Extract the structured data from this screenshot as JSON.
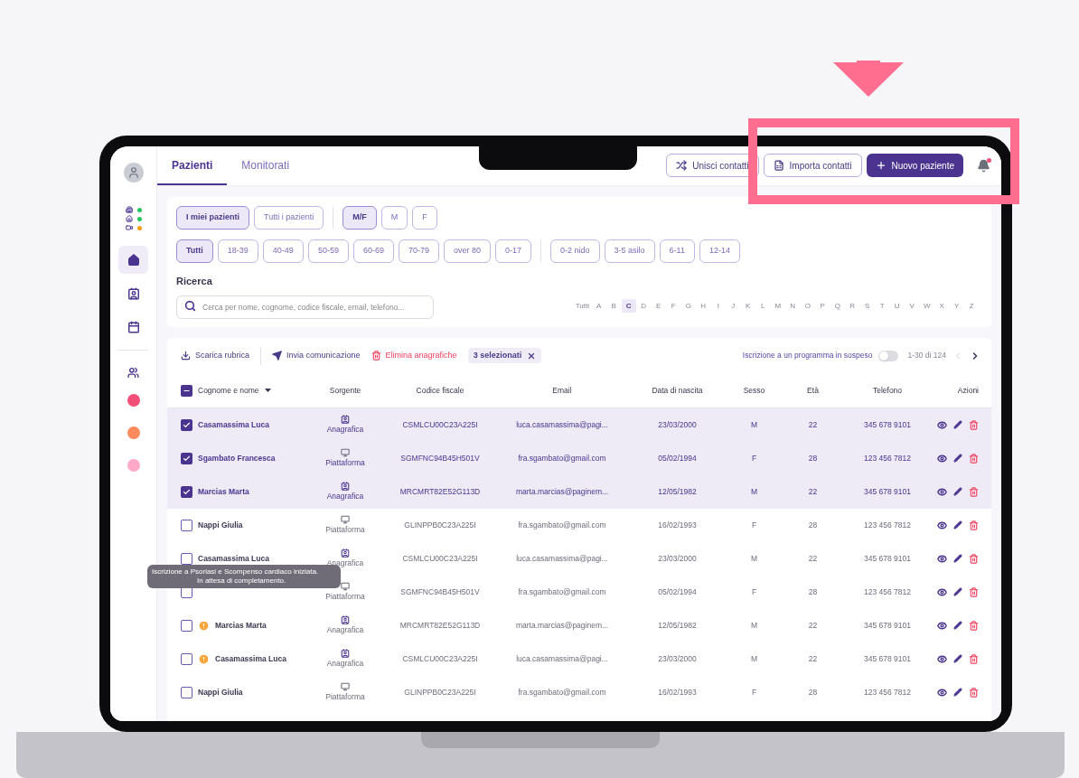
{
  "sidebar": {
    "status": [
      {
        "kind": "building",
        "color": "#22c55e"
      },
      {
        "kind": "home",
        "color": "#22c55e"
      },
      {
        "kind": "video",
        "color": "#f59e0b"
      }
    ],
    "nav": [
      {
        "kind": "home",
        "selected": true
      },
      {
        "kind": "contact",
        "selected": false
      },
      {
        "kind": "calendar",
        "selected": false
      }
    ],
    "groups": [
      {
        "kind": "people"
      }
    ],
    "circles": [
      {
        "color": "#f04f78"
      },
      {
        "color": "#ff8a5c"
      },
      {
        "color": "#ffa9c6"
      }
    ]
  },
  "tabs": [
    {
      "label": "Pazienti",
      "selected": true
    },
    {
      "label": "Monitorati",
      "selected": false
    }
  ],
  "actions": [
    {
      "kind": "merge",
      "label": "Unisci contatti"
    },
    {
      "kind": "import",
      "label": "Importa contatti"
    },
    {
      "kind": "primary",
      "label": "Nuovo paziente"
    }
  ],
  "notifications": {
    "unread": true
  },
  "filters": {
    "scope": [
      {
        "label": "I miei pazienti",
        "selected": true
      },
      {
        "label": "Tutti i pazienti",
        "selected": false
      }
    ],
    "gender": [
      {
        "label": "M/F",
        "selected": true
      },
      {
        "label": "M",
        "selected": false
      },
      {
        "label": "F",
        "selected": false
      }
    ],
    "age": [
      {
        "label": "Tutti",
        "selected": true
      },
      {
        "label": "18-39",
        "selected": false
      },
      {
        "label": "40-49",
        "selected": false
      },
      {
        "label": "50-59",
        "selected": false
      },
      {
        "label": "60-69",
        "selected": false
      },
      {
        "label": "70-79",
        "selected": false
      },
      {
        "label": "over 80",
        "selected": false
      },
      {
        "label": "0-17",
        "selected": false
      }
    ],
    "child_age": [
      {
        "label": "0-2 nido",
        "selected": false
      },
      {
        "label": "3-5 asilo",
        "selected": false
      },
      {
        "label": "6-11",
        "selected": false
      },
      {
        "label": "12-14",
        "selected": false
      }
    ],
    "search_label": "Ricerca",
    "search": {
      "placeholder": "Cerca per nome, cognome, codice fiscale, email, telefono..."
    },
    "letters": [
      {
        "label": "Tutti",
        "selected": false
      },
      {
        "label": "A",
        "selected": false
      },
      {
        "label": "B",
        "selected": false
      },
      {
        "label": "C",
        "selected": true
      },
      {
        "label": "D",
        "selected": false
      },
      {
        "label": "E",
        "selected": false
      },
      {
        "label": "F",
        "selected": false
      },
      {
        "label": "G",
        "selected": false
      },
      {
        "label": "H",
        "selected": false
      },
      {
        "label": "I",
        "selected": false
      },
      {
        "label": "J",
        "selected": false
      },
      {
        "label": "K",
        "selected": false
      },
      {
        "label": "L",
        "selected": false
      },
      {
        "label": "M",
        "selected": false
      },
      {
        "label": "N",
        "selected": false
      },
      {
        "label": "O",
        "selected": false
      },
      {
        "label": "P",
        "selected": false
      },
      {
        "label": "Q",
        "selected": false
      },
      {
        "label": "R",
        "selected": false
      },
      {
        "label": "S",
        "selected": false
      },
      {
        "label": "T",
        "selected": false
      },
      {
        "label": "U",
        "selected": false
      },
      {
        "label": "V",
        "selected": false
      },
      {
        "label": "W",
        "selected": false
      },
      {
        "label": "X",
        "selected": false
      },
      {
        "label": "Y",
        "selected": false
      },
      {
        "label": "Z",
        "selected": false
      }
    ]
  },
  "toolbar": {
    "tools": [
      {
        "kind": "download",
        "label": "Scarica rubrica"
      },
      {
        "kind": "send",
        "label": "Invia comunicazione"
      },
      {
        "kind": "delete",
        "label": "Elimina anagrafiche"
      }
    ],
    "selection": "3 selezionati",
    "pending_label": "Iscrizione a un programma in sospeso",
    "pending_on": false,
    "range": "1-30 di 124",
    "prev_disabled": true,
    "next_disabled": false
  },
  "table": {
    "all_indeterminate": true,
    "columns": [
      "Cognome e nome",
      "Sorgente",
      "Codice fiscale",
      "Email",
      "Data di nascita",
      "Sesso",
      "Età",
      "Telefono",
      "Azioni"
    ],
    "rows": [
      {
        "checked": true,
        "warning": false,
        "name": "Casamassima Luca",
        "kind": "registry",
        "source": "Anagrafica",
        "code": "CSMLCU00C23A225I",
        "email": "luca.casamassima@pagi...",
        "birth": "23/03/2000",
        "sex": "M",
        "age": "22",
        "phone": "345 678 9101"
      },
      {
        "checked": true,
        "warning": false,
        "name": "Sgambato Francesca",
        "kind": "platform",
        "source": "Piattaforma",
        "code": "SGMFNC94B45H501V",
        "email": "fra.sgambato@gmail.com",
        "birth": "05/02/1994",
        "sex": "F",
        "age": "28",
        "phone": "123 456 7812"
      },
      {
        "checked": true,
        "warning": false,
        "name": "Marcias Marta",
        "kind": "registry",
        "source": "Anagrafica",
        "code": "MRCMRT82E52G113D",
        "email": "marta.marcias@paginem...",
        "birth": "12/05/1982",
        "sex": "M",
        "age": "22",
        "phone": "345 678 9101"
      },
      {
        "checked": false,
        "warning": false,
        "name": "Nappi Giulia",
        "kind": "platform",
        "source": "Piattaforma",
        "code": "GLINPPB0C23A225I",
        "email": "fra.sgambato@gmail.com",
        "birth": "16/02/1993",
        "sex": "F",
        "age": "28",
        "phone": "123 456 7812"
      },
      {
        "checked": false,
        "warning": false,
        "name": "Casamassima Luca",
        "kind": "registry",
        "source": "Anagrafica",
        "code": "CSMLCU00C23A225I",
        "email": "luca.casamassima@pagi...",
        "birth": "23/03/2000",
        "sex": "M",
        "age": "22",
        "phone": "345 678 9101"
      },
      {
        "checked": false,
        "warning": false,
        "kind": "platform",
        "source": "Piattaforma",
        "code": "SGMFNC94B45H501V",
        "email": "fra.sgambato@gmail.com",
        "birth": "05/02/1994",
        "sex": "F",
        "age": "28",
        "phone": "123 456 7812",
        "tooltip": [
          "Iscrizione a Psoriasi e Scompenso cardiaco iniziata.",
          "In attesa di completamento."
        ]
      },
      {
        "checked": false,
        "warning": true,
        "name": "Marcias Marta",
        "kind": "registry",
        "source": "Anagrafica",
        "code": "MRCMRT82E52G113D",
        "email": "marta.marcias@paginem...",
        "birth": "12/05/1982",
        "sex": "M",
        "age": "22",
        "phone": "345 678 9101"
      },
      {
        "checked": false,
        "warning": true,
        "name": "Casamassima Luca",
        "kind": "registry",
        "source": "Anagrafica",
        "code": "CSMLCU00C23A225I",
        "email": "luca.casamassima@pagi...",
        "birth": "23/03/2000",
        "sex": "M",
        "age": "22",
        "phone": "345 678 9101"
      },
      {
        "checked": false,
        "warning": false,
        "name": "Nappi Giulia",
        "kind": "platform",
        "source": "Piattaforma",
        "code": "GLINPPB0C23A225I",
        "email": "fra.sgambato@gmail.com",
        "birth": "16/02/1993",
        "sex": "F",
        "age": "28",
        "phone": "123 456 7812"
      }
    ]
  }
}
